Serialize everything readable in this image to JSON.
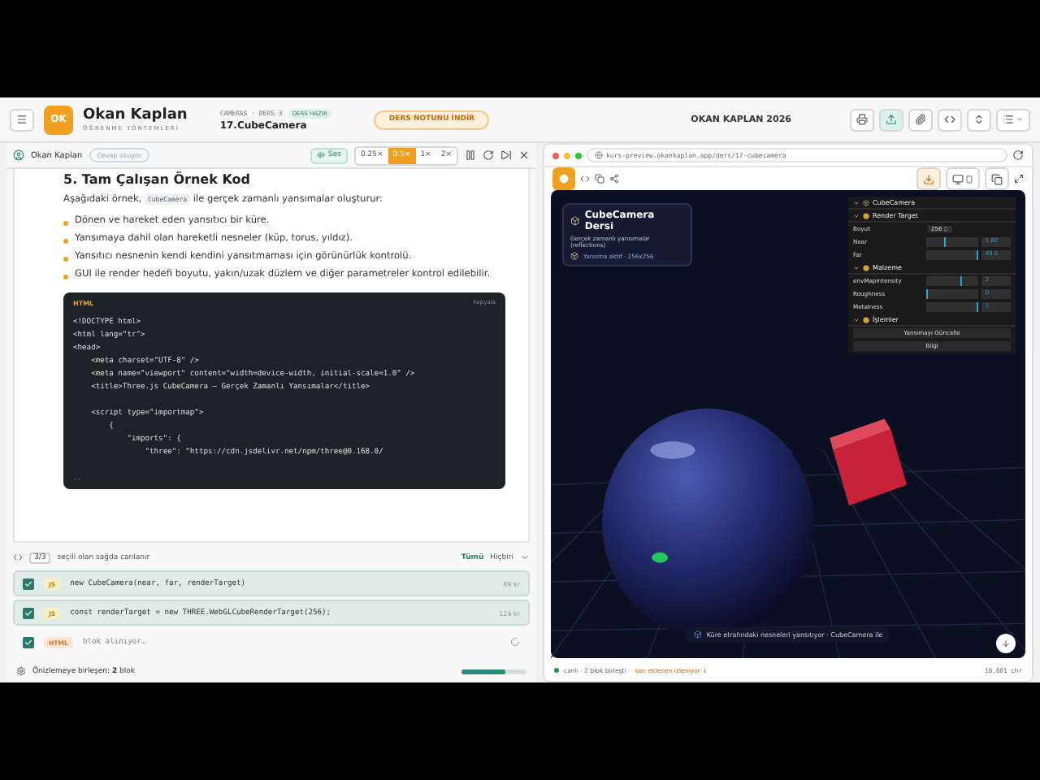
{
  "header": {
    "logo": "OK",
    "name": "Okan Kaplan",
    "subtitle": "ÖĞRENME YÖNTEMLERİ",
    "breadcrumb": "CAMERAS · DERS 3",
    "status_badge": "DERS HAZIR",
    "lesson_title": "17.CubeCamera",
    "download_button": "DERS NOTUNU İNDİR",
    "brand": "OKAN KAPLAN 2026"
  },
  "narrator": {
    "name": "Okan Kaplan",
    "status": "Cevap okuyor",
    "sound": "Ses",
    "speeds": [
      {
        "label": "0.25×",
        "selected": false
      },
      {
        "label": "0.5×",
        "selected": true
      },
      {
        "label": "1×",
        "selected": false
      },
      {
        "label": "2×",
        "selected": false
      }
    ]
  },
  "content": {
    "heading": "5. Tam Çalışan Örnek Kod",
    "intro_before": "Aşağıdaki örnek,",
    "intro_code": "CubeCamera",
    "intro_after": "ile gerçek zamanlı yansımalar oluşturur:",
    "bullets": [
      "Dönen ve hareket eden yansıtıcı bir küre.",
      "Yansımaya dahil olan hareketli nesneler (küp, torus, yıldız).",
      "Yansıtıcı nesnenin kendi kendini yansıtmaması için görünürlük kontrolü.",
      "GUI ile render hedefi boyutu, yakın/uzak düzlem ve diğer parametreler kontrol edilebilir."
    ],
    "code_block": {
      "language": "HTML",
      "copy": "kopyala",
      "more": "...",
      "groups": [
        [
          "<!DOCTYPE html>",
          "<html lang=\"tr\">",
          "<head>",
          "    <meta charset=\"UTF-8\" />",
          "    <meta name=\"viewport\" content=\"width=device-width, initial-scale=1.0\" />",
          "    <title>Three.js CubeCamera – Gerçek Zamanlı Yansımalar</title>"
        ],
        [
          "    <script type=\"importmap\">",
          "        {",
          "            \"imports\": {",
          "                \"three\": \"https://cdn.jsdelivr.net/npm/three@0.168.0/"
        ]
      ]
    }
  },
  "snippets": {
    "count": "3/3",
    "hint": "seçili olan sağda canlanır",
    "all": "Tümü",
    "none": "Hiçbiri",
    "items": [
      {
        "kind": "ready",
        "checked": true,
        "lang": "JS",
        "code": "new CubeCamera(near, far, renderTarget)",
        "size": "89 kr"
      },
      {
        "kind": "ready",
        "checked": true,
        "lang": "JS",
        "code": "const renderTarget = new THREE.WebGLCubeRenderTarget(256);",
        "size": "124 kr"
      },
      {
        "kind": "loading",
        "checked": true,
        "lang": "HTML",
        "code": "blok alınıyor…"
      }
    ]
  },
  "footer": {
    "text": "Önizlemeye birleşen: **2** blok",
    "level": 0.68
  },
  "preview": {
    "url": "kurs-preview.okankaplan.app/ders/17-cubecamera",
    "card": {
      "title": "CubeCamera Dersi",
      "subtitle": "Gerçek zamanlı yansımalar (reflections)",
      "status": "Yansıma aktif · 256x256"
    },
    "gui": {
      "title": "CubeCamera",
      "folders": [
        {
          "title": "Render Target",
          "rows": [
            {
              "kind": "select",
              "label": "Boyut",
              "value": "256"
            },
            {
              "kind": "slider",
              "label": "Near",
              "value": "1.60",
              "level": 0.35
            },
            {
              "kind": "slider",
              "label": "Far",
              "value": "49.5",
              "level": 0.98
            }
          ]
        },
        {
          "title": "Malzeme",
          "rows": [
            {
              "kind": "slider",
              "label": "envMapIntensity",
              "value": "2",
              "level": 0.67
            },
            {
              "kind": "slider",
              "label": "Roughness",
              "value": "0",
              "level": 0
            },
            {
              "kind": "slider",
              "label": "Metalness",
              "value": "1",
              "level": 1
            }
          ]
        },
        {
          "title": "İşlemler",
          "rows": [
            {
              "kind": "button",
              "label": "Yansımayı Güncelle"
            },
            {
              "kind": "button",
              "label": "Bilgi"
            }
          ]
        }
      ]
    },
    "caption": "Küre etrafındaki nesneleri yansıtıyor · CubeCamera ile",
    "status_left": "canlı · 2 blok birleşti ·",
    "status_link": "son eklenen izleniyor ↓",
    "chars": "16.601 chr"
  }
}
